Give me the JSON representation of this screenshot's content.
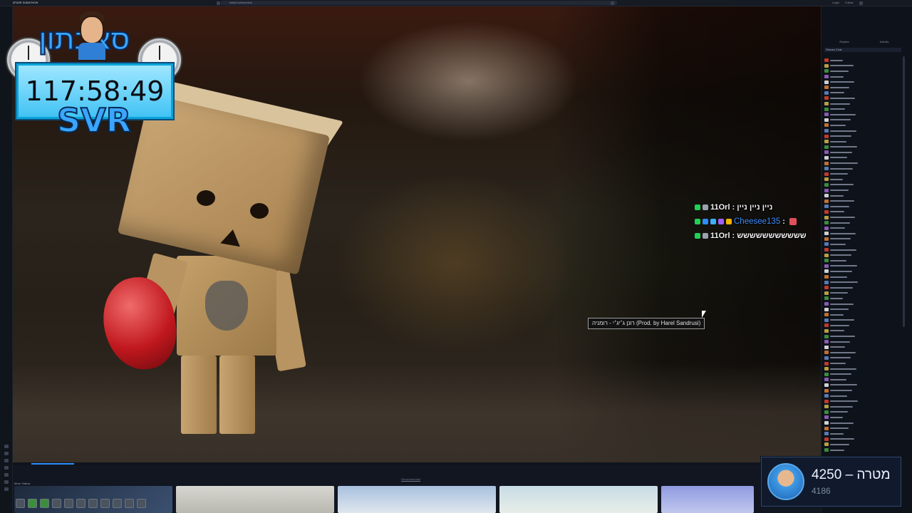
{
  "browser": {
    "title": "סאבתון SUBATHON",
    "url": "twitch.tv/iamorshe",
    "right_items": [
      "Login",
      "Follow"
    ]
  },
  "timer": {
    "title": "סאבתון",
    "time": "117:58:49",
    "subtitle": "SVR"
  },
  "chat_overlay": {
    "messages": [
      {
        "user": "11Orl",
        "text": "ניין ניין ניין"
      },
      {
        "user": "Cheesee135",
        "text": ""
      },
      {
        "user": "11Orl",
        "text": "ששששששששששש"
      }
    ],
    "separator": ":"
  },
  "now_playing": {
    "text": "רונן ג׳יג׳י - רומניה (Prod. by Harel Sandrusi)"
  },
  "side_panel": {
    "tabs": [
      "Replies",
      "Activity"
    ],
    "header": "Stream Chat"
  },
  "bottom": {
    "label": "More Videos",
    "note": "Recommended"
  },
  "goal": {
    "label": "מטרה",
    "target": "4250",
    "separator": "–",
    "current": "4186"
  },
  "colors": {
    "accent_blue": "#3aa6ff",
    "chat_name_blue": "#3c8dff",
    "timer_box": "#42c3f4"
  }
}
